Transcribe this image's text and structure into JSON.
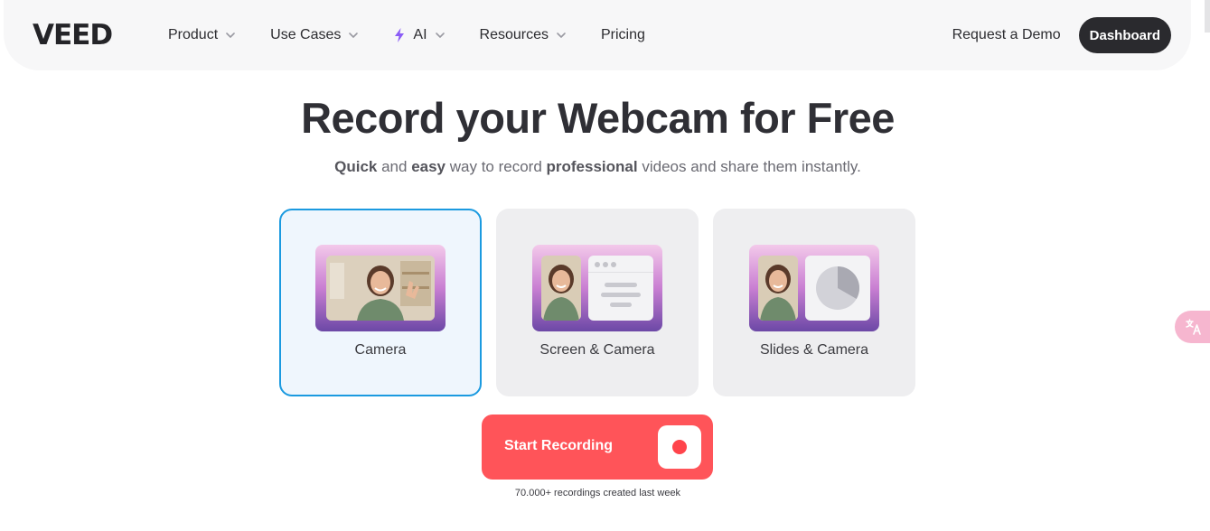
{
  "nav": {
    "logo": "VEED",
    "links": [
      {
        "label": "Product",
        "has_dropdown": true
      },
      {
        "label": "Use Cases",
        "has_dropdown": true
      },
      {
        "label": "AI",
        "has_dropdown": true,
        "icon": "lightning-icon"
      },
      {
        "label": "Resources",
        "has_dropdown": true
      },
      {
        "label": "Pricing",
        "has_dropdown": false
      }
    ],
    "request_demo": "Request a Demo",
    "dashboard": "Dashboard"
  },
  "hero": {
    "title": "Record your Webcam for Free",
    "subtitle": {
      "w1": "Quick",
      "t1": " and ",
      "w2": "easy",
      "t2": " way to record ",
      "w3": "professional",
      "t3": " videos and share them instantly."
    }
  },
  "options": [
    {
      "label": "Camera",
      "selected": true
    },
    {
      "label": "Screen & Camera",
      "selected": false
    },
    {
      "label": "Slides & Camera",
      "selected": false
    }
  ],
  "start": {
    "label": "Start Recording",
    "count": "70.000+ recordings created last week"
  },
  "colors": {
    "accent_red": "#ff5459",
    "selected_border": "#1b9ae0",
    "dark": "#2a2a2e",
    "ai_bolt": "#8b5cf6"
  },
  "translate_widget": {
    "icon": "translate-icon"
  }
}
